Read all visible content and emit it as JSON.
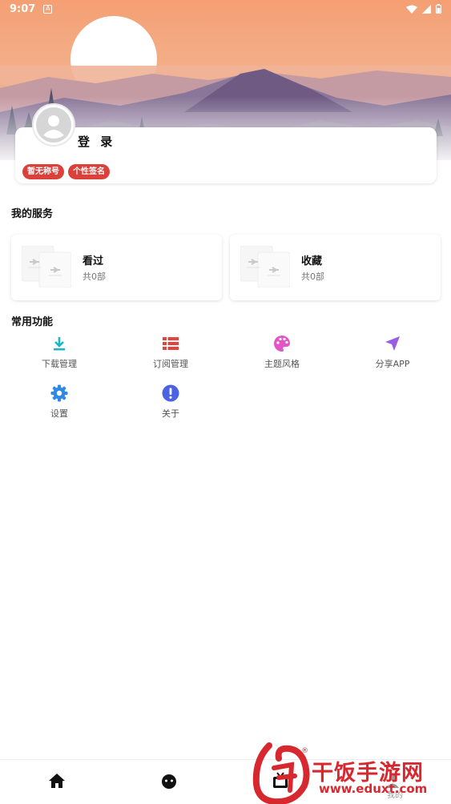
{
  "status_bar": {
    "time": "9:07"
  },
  "profile": {
    "login_label": "登 录",
    "tags": [
      "暂无称号",
      "个性签名"
    ]
  },
  "services": {
    "title": "我的服务",
    "items": [
      {
        "label": "看过",
        "count": "共0部"
      },
      {
        "label": "收藏",
        "count": "共0部"
      }
    ]
  },
  "functions": {
    "title": "常用功能",
    "items": [
      {
        "label": "下载管理",
        "icon": "download-icon",
        "color": "#1bb5c9"
      },
      {
        "label": "订阅管理",
        "icon": "list-icon",
        "color": "#e0443b"
      },
      {
        "label": "主题风格",
        "icon": "palette-icon",
        "color": "#e255c6"
      },
      {
        "label": "分享APP",
        "icon": "send-icon",
        "color": "#9b5de5"
      },
      {
        "label": "设置",
        "icon": "gear-icon",
        "color": "#2f8ae5"
      },
      {
        "label": "关于",
        "icon": "info-icon",
        "color": "#4a62e3"
      }
    ]
  },
  "bottom_nav": {
    "items": [
      {
        "icon": "home-icon"
      },
      {
        "icon": "face-icon"
      },
      {
        "icon": "tv-icon"
      },
      {
        "icon": "profile-icon",
        "label": "我的"
      }
    ]
  },
  "watermark": {
    "text": "干饭手游网",
    "url": "www.eduxt.com",
    "mark": "®"
  },
  "colors": {
    "accent": "#d9413a",
    "sky_top": "#f3a477",
    "mountain": "#6f5a84"
  }
}
